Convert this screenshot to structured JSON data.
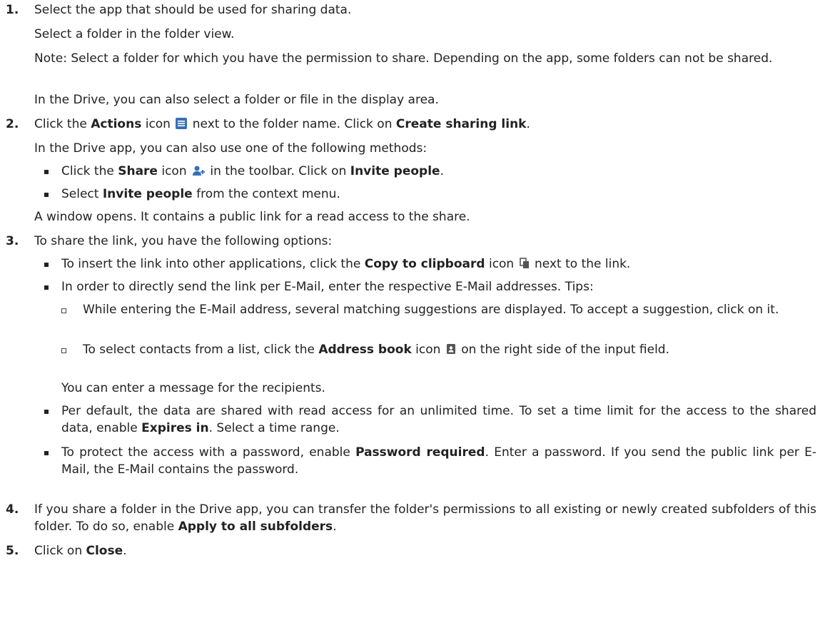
{
  "steps": [
    {
      "number": "1.",
      "text": "Select the app that should be used for sharing data.",
      "paras": [
        "Select a folder in the folder view.",
        "Note: Select a folder for which you have the permission to share. Depending on the app, some folders can not be shared.",
        "In the Drive, you can also select a folder or file in the display area."
      ]
    },
    {
      "number": "2.",
      "t1": "Click the ",
      "actions": "Actions",
      "t2": " icon",
      "t3": " next to the folder name. Click on ",
      "create_link": "Create sharing link",
      "t4": ".",
      "para1": "In the Drive app, you can also use one of the following methods:",
      "bullets": [
        {
          "a": "Click the ",
          "b": "Share",
          "c": " icon",
          "d": " in the toolbar. Click on ",
          "e": "Invite people",
          "f": "."
        },
        {
          "a": "Select ",
          "b": "Invite people",
          "c": " from the context menu."
        }
      ],
      "para2": "A window opens. It contains a public link for a read access to the share."
    },
    {
      "number": "3.",
      "text": "To share the link, you have the following options:",
      "b1": {
        "a": "To insert the link into other applications, click the ",
        "b": "Copy to clipboard",
        "c": " icon",
        "d": " next to the link."
      },
      "b2": "In order to directly send the link per E-Mail, enter the respective E-Mail addresses. Tips:",
      "sub1": "While entering the E-Mail address, several matching suggestions are displayed. To accept a suggestion, click on it.",
      "sub2": {
        "a": "To select contacts from a list, click the ",
        "b": "Address book",
        "c": " icon",
        "d": " on the right side of the input field."
      },
      "b2_tail": "You can enter a message for the recipients.",
      "b3": {
        "a": "Per default, the data are shared with read access for an unlimited time. To set a time limit for the access to the shared data, enable ",
        "b": "Expires in",
        "c": ". Select a time range."
      },
      "b4": {
        "a": "To protect the access with a password, enable ",
        "b": "Password required",
        "c": ". Enter a password. If you send the public link per E-Mail, the E-Mail contains the password."
      }
    },
    {
      "number": "4.",
      "a": "If you share a folder in the Drive app, you can transfer the folder's permissions to all existing or newly created subfolders of this folder. To do so, enable ",
      "b": "Apply to all subfolders",
      "c": "."
    },
    {
      "number": "5.",
      "a": "Click on ",
      "b": "Close",
      "c": "."
    }
  ],
  "icons": {
    "actions": "list-icon",
    "share": "add-user-icon",
    "copy": "copy-icon",
    "address_book": "address-book-icon"
  },
  "colors": {
    "actions_icon": "#3a6fb8",
    "share_icon": "#3a6fb8",
    "copy_icon": "#555555",
    "address_icon": "#555555"
  }
}
